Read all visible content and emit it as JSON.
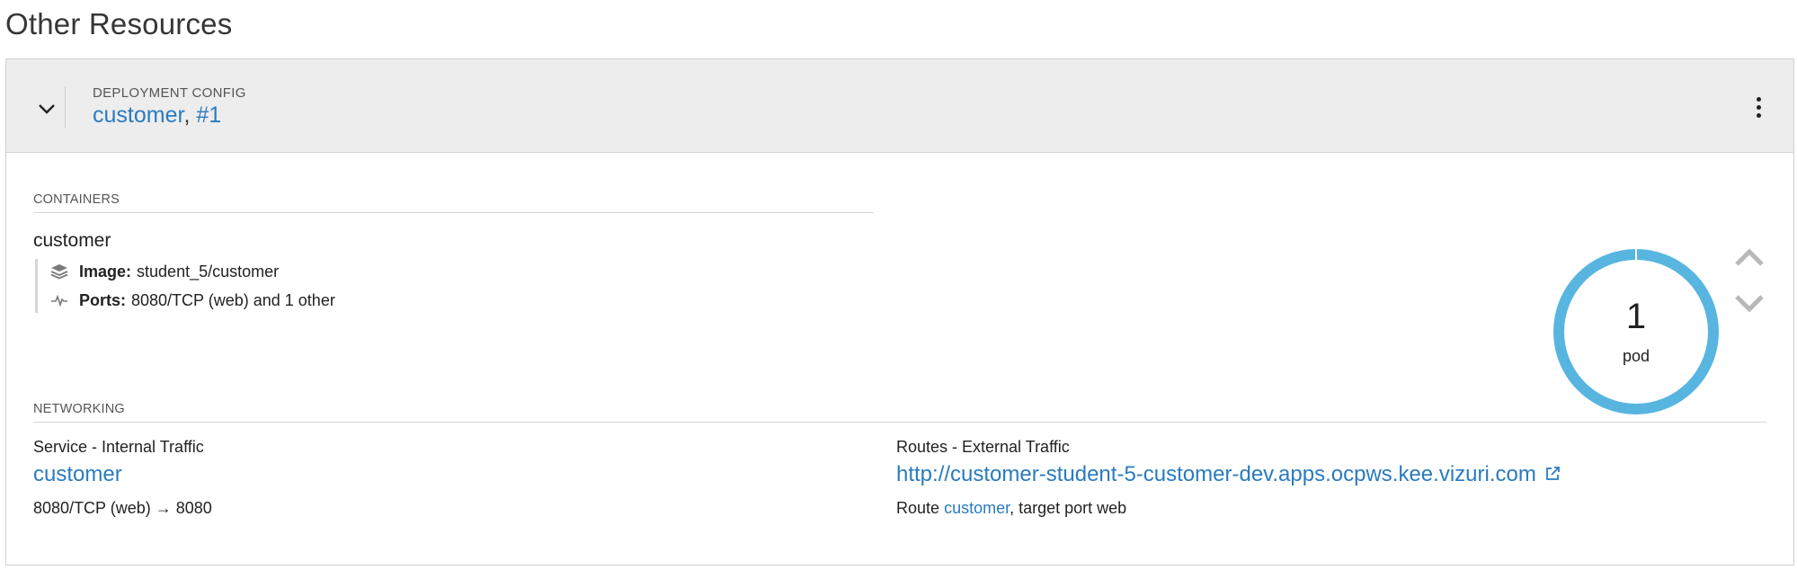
{
  "page": {
    "title": "Other Resources"
  },
  "deployment": {
    "kind_label": "DEPLOYMENT CONFIG",
    "name": "customer",
    "separator": ",",
    "revision": "#1"
  },
  "containers": {
    "section_label": "CONTAINERS",
    "name": "customer",
    "image_label": "Image:",
    "image_value": "student_5/customer",
    "ports_label": "Ports:",
    "ports_value": "8080/TCP (web) and 1 other"
  },
  "pods": {
    "count": "1",
    "label": "pod",
    "ring_color": "#57b5e0"
  },
  "networking": {
    "section_label": "NETWORKING",
    "service": {
      "heading": "Service - Internal Traffic",
      "name": "customer",
      "ports_from": "8080/TCP (web)",
      "arrow": "→",
      "ports_to": "8080"
    },
    "routes": {
      "heading": "Routes - External Traffic",
      "url": "http://customer-student-5-customer-dev.apps.ocpws.kee.vizuri.com",
      "route_prefix": "Route",
      "route_name": "customer",
      "route_suffix": ", target port web"
    }
  },
  "icons": {
    "expand": "chevron-down-icon",
    "menu": "kebab-icon",
    "image": "layers-icon",
    "ports": "pulse-icon",
    "scale_up": "chevron-up-icon",
    "scale_down": "chevron-down-icon",
    "external_link": "external-link-icon"
  },
  "colors": {
    "link": "#2a7bc1",
    "header_bg": "#ededed"
  }
}
